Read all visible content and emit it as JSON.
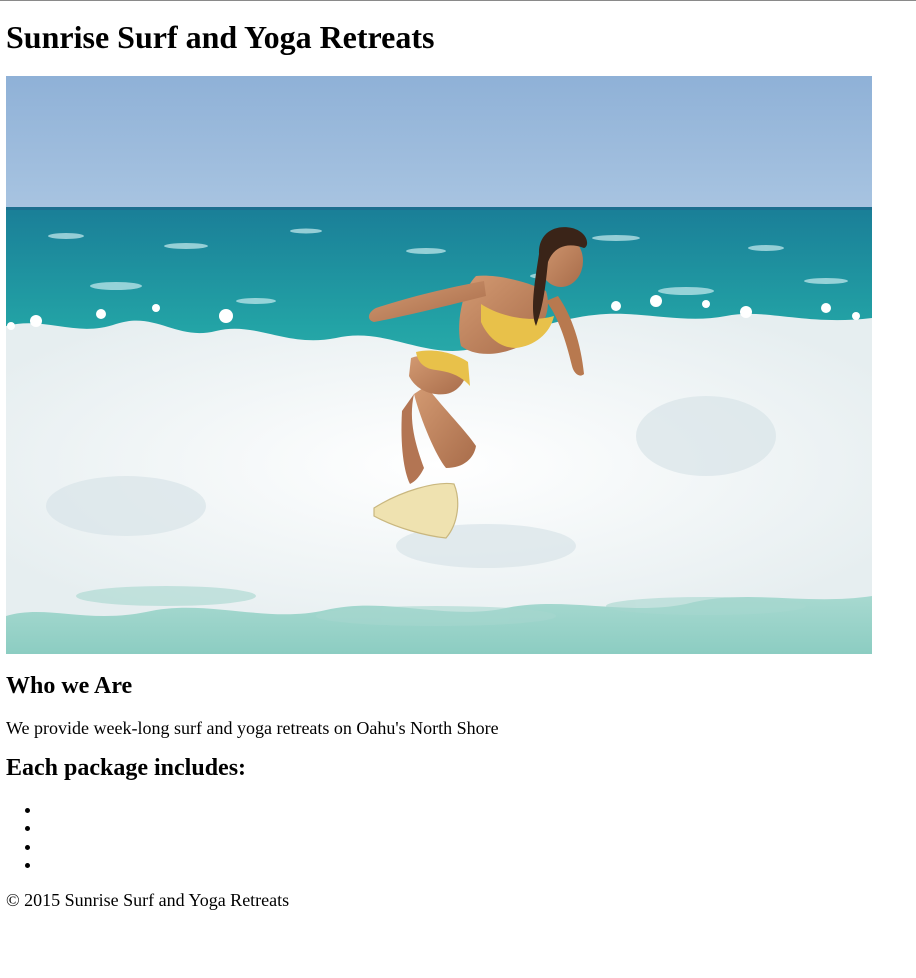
{
  "header": {
    "title": "Sunrise Surf and Yoga Retreats"
  },
  "hero": {
    "image_name": "surfer-photo",
    "colors": {
      "sky_top": "#8fb2d8",
      "sky_bottom": "#a9c6e2",
      "sea_deep": "#1f8f9c",
      "sea_teal": "#2aa8a8",
      "foam": "#f4f7f8",
      "shallow": "#8fd0c6",
      "swimsuit": "#e8c14a",
      "skin": "#c48a62",
      "board": "#efe2b0"
    }
  },
  "about": {
    "heading": "Who we Are",
    "text": "We provide week-long surf and yoga retreats on Oahu's North Shore"
  },
  "packages": {
    "heading": "Each package includes:",
    "items": [
      "",
      "",
      "",
      ""
    ]
  },
  "footer": {
    "text": "© 2015 Sunrise Surf and Yoga Retreats"
  }
}
